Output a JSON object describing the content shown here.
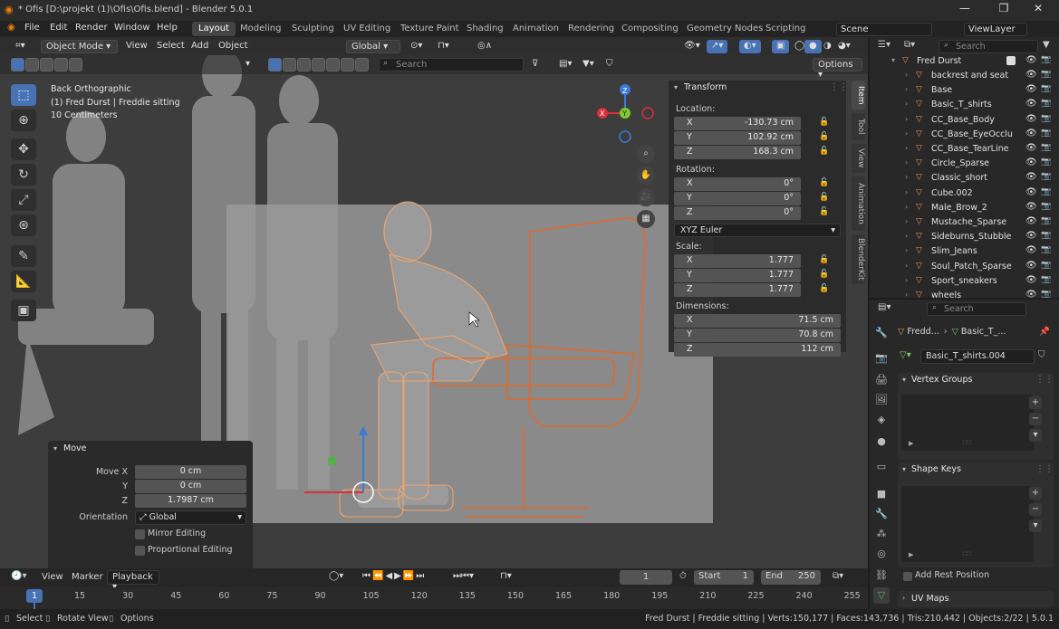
{
  "window": {
    "title": "* Ofis [D:\\projekt (1)\\Ofis\\Ofis.blend] - Blender 5.0.1",
    "minimize": "—",
    "maximize": "❐",
    "close": "✕"
  },
  "menu": {
    "items": [
      "File",
      "Edit",
      "Render",
      "Window",
      "Help"
    ],
    "workspaces": [
      "Layout",
      "Modeling",
      "Sculpting",
      "UV Editing",
      "Texture Paint",
      "Shading",
      "Animation",
      "Rendering",
      "Compositing",
      "Geometry Nodes",
      "Scripting"
    ],
    "scene": "Scene",
    "view_layer": "ViewLayer"
  },
  "viewport": {
    "mode": "Object Mode",
    "menus": [
      "View",
      "Select",
      "Add",
      "Object"
    ],
    "orientation": "Global",
    "search_placeholder": "Search",
    "options": "Options",
    "overlay_info": [
      "Back Orthographic",
      "(1) Fred Durst | Freddie sitting",
      "10 Centimeters"
    ],
    "gizmo": {
      "x": "X",
      "y": "Y",
      "z": "Z"
    }
  },
  "npanel": {
    "header": "Transform",
    "location_label": "Location:",
    "location": [
      {
        "k": "X",
        "v": "-130.73 cm"
      },
      {
        "k": "Y",
        "v": "102.92 cm"
      },
      {
        "k": "Z",
        "v": "168.3 cm"
      }
    ],
    "rotation_label": "Rotation:",
    "rotation": [
      {
        "k": "X",
        "v": "0°"
      },
      {
        "k": "Y",
        "v": "0°"
      },
      {
        "k": "Z",
        "v": "0°"
      }
    ],
    "rotation_mode": "XYZ Euler",
    "scale_label": "Scale:",
    "scale": [
      {
        "k": "X",
        "v": "1.777"
      },
      {
        "k": "Y",
        "v": "1.777"
      },
      {
        "k": "Z",
        "v": "1.777"
      }
    ],
    "dimensions_label": "Dimensions:",
    "dimensions": [
      {
        "k": "X",
        "v": "71.5 cm"
      },
      {
        "k": "Y",
        "v": "70.8 cm"
      },
      {
        "k": "Z",
        "v": "112 cm"
      }
    ],
    "tabs": [
      "Item",
      "Tool",
      "View",
      "Animation",
      "BlenderKit"
    ]
  },
  "move_panel": {
    "title": "Move",
    "fields": [
      {
        "k": "Move X",
        "v": "0 cm"
      },
      {
        "k": "Y",
        "v": "0 cm"
      },
      {
        "k": "Z",
        "v": "1.7987 cm"
      }
    ],
    "orientation_label": "Orientation",
    "orientation": "Global",
    "mirror": "Mirror Editing",
    "proportional": "Proportional Editing"
  },
  "outliner": {
    "search_placeholder": "Search",
    "root": "Fred Durst",
    "items": [
      "backrest and seat",
      "Base",
      "Basic_T_shirts",
      "CC_Base_Body",
      "CC_Base_EyeOcclu",
      "CC_Base_TearLine",
      "Circle_Sparse",
      "Classic_short",
      "Cube.002",
      "Male_Brow_2",
      "Mustache_Sparse",
      "Sideburns_Stubble",
      "Slim_Jeans",
      "Soul_Patch_Sparse",
      "Sport_sneakers",
      "wheels"
    ]
  },
  "properties": {
    "search_placeholder": "Search",
    "breadcrumb_obj": "Fredd...",
    "breadcrumb_mesh": "Basic_T_...",
    "mesh_name": "Basic_T_shirts.004",
    "vertex_groups": "Vertex Groups",
    "shape_keys": "Shape Keys",
    "add_rest": "Add Rest Position",
    "uv_maps": "UV Maps"
  },
  "timeline": {
    "menus": [
      "View",
      "Marker",
      "Playback"
    ],
    "frame": "1",
    "start_label": "Start",
    "start": "1",
    "end_label": "End",
    "end": "250",
    "ticks": [
      "15",
      "30",
      "45",
      "60",
      "75",
      "90",
      "105",
      "120",
      "135",
      "150",
      "165",
      "180",
      "195",
      "210",
      "225",
      "240",
      "255"
    ],
    "current": "1"
  },
  "status": {
    "select": "Select",
    "rotate": "Rotate View",
    "options": "Options",
    "info": "Fred Durst | Freddie sitting | Verts:150,177 | Faces:143,736 | Tris:210,442 | Objects:2/22 | 5.0.1"
  }
}
